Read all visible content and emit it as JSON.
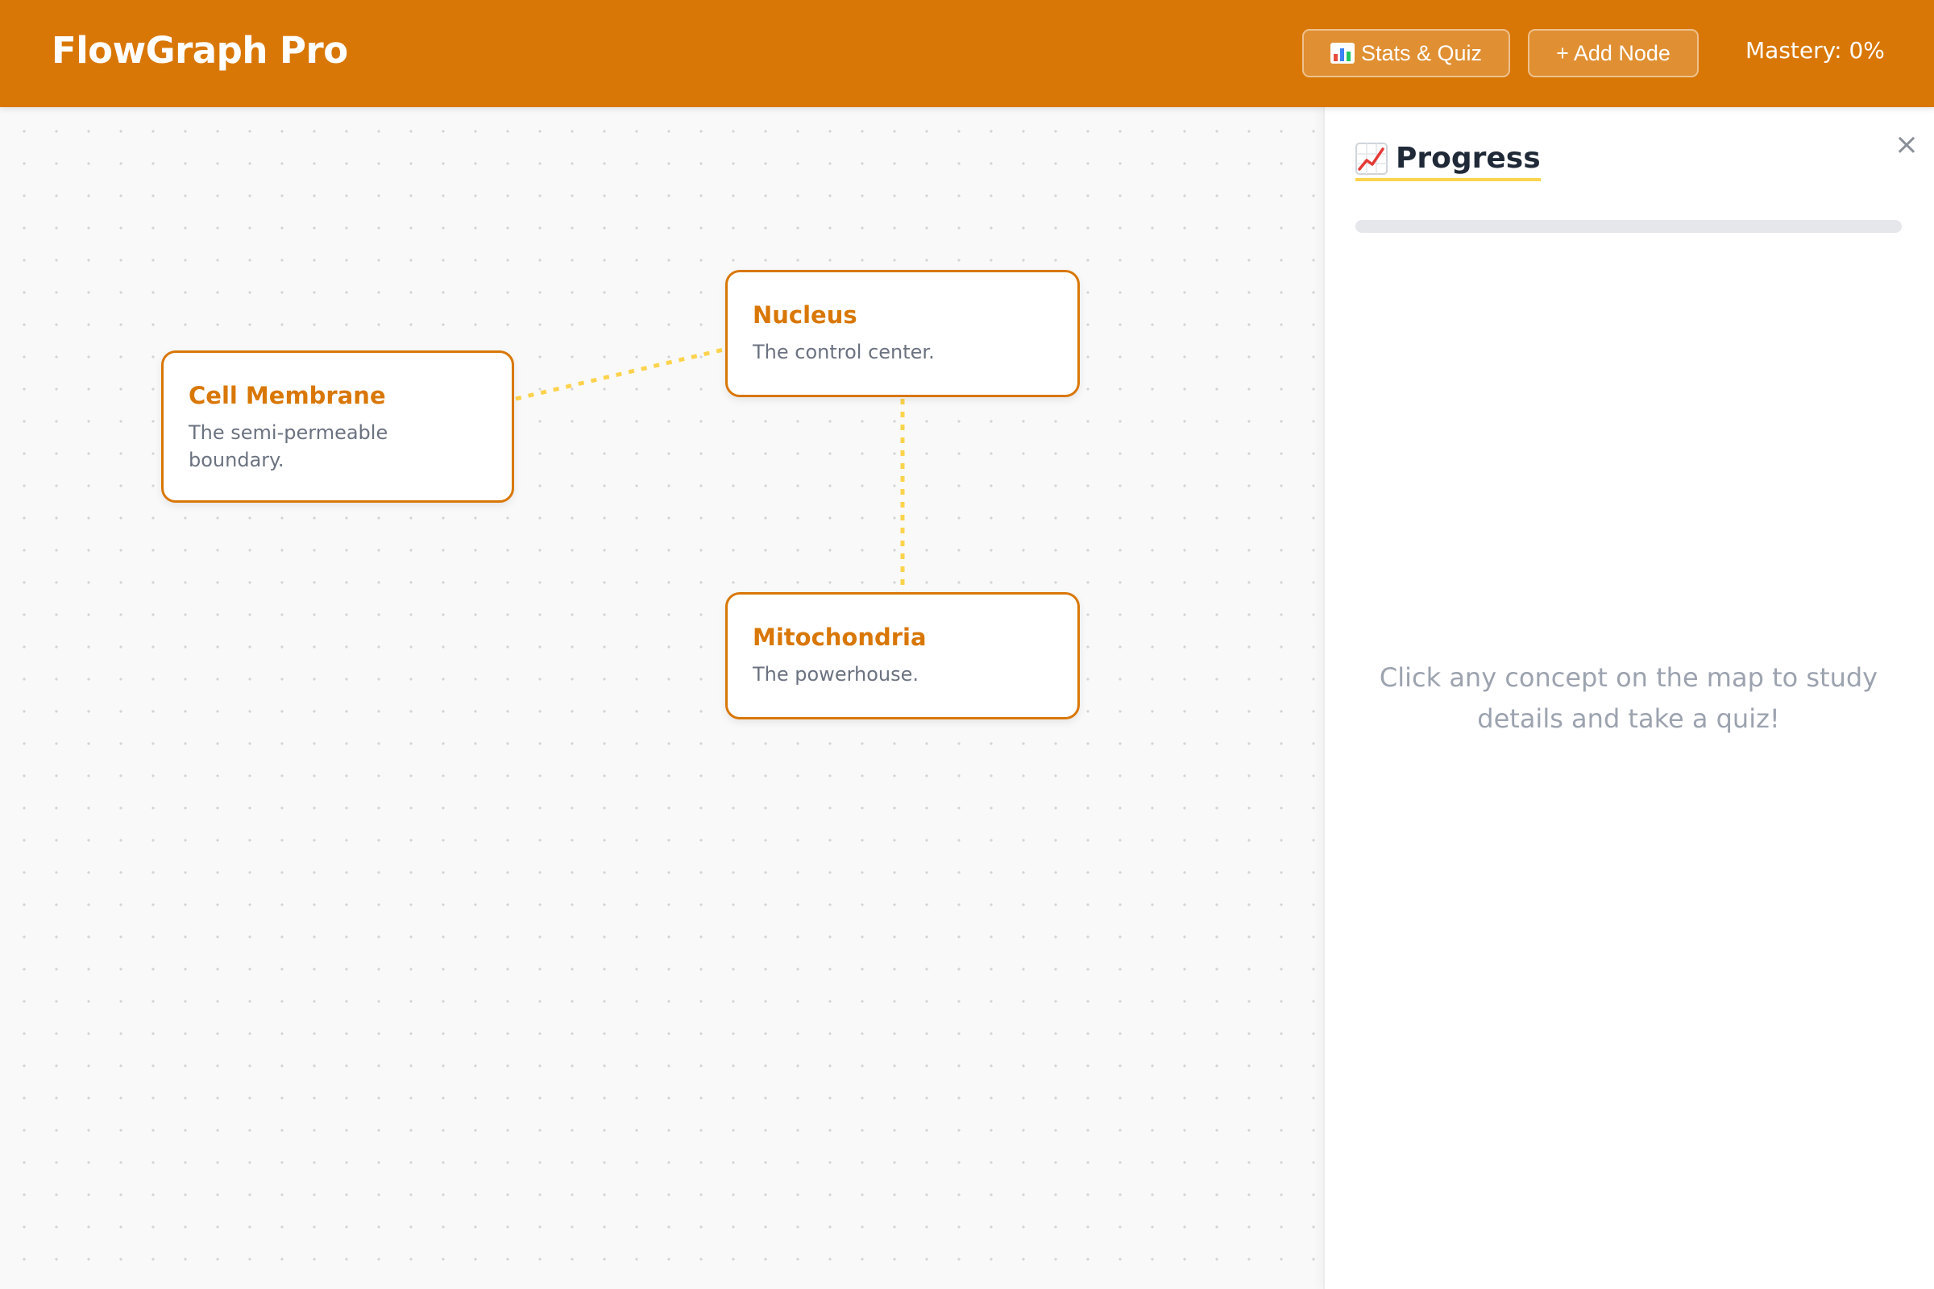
{
  "header": {
    "app_title": "FlowGraph Pro",
    "stats_button_label": "Stats & Quiz",
    "stats_button_icon": "bar-chart-icon",
    "add_node_button_label": "+ Add Node",
    "mastery_text": "Mastery: 0%"
  },
  "canvas": {
    "nodes": [
      {
        "id": "cell-membrane",
        "title": "Cell Membrane",
        "description": "The semi-permeable boundary."
      },
      {
        "id": "nucleus",
        "title": "Nucleus",
        "description": "The control center."
      },
      {
        "id": "mitochondria",
        "title": "Mitochondria",
        "description": "The powerhouse."
      }
    ],
    "edges": [
      {
        "from": "cell-membrane",
        "to": "nucleus"
      },
      {
        "from": "nucleus",
        "to": "mitochondria"
      }
    ]
  },
  "panel": {
    "title": "Progress",
    "title_icon": "trending-chart-icon",
    "close_icon": "close-icon",
    "progress_fraction": 0,
    "empty_message": "Click any concept on the map to study details and take a quiz!"
  },
  "colors": {
    "accent": "#d97706",
    "edge": "#fcd34d",
    "panel_text_muted": "#9ca3af"
  }
}
